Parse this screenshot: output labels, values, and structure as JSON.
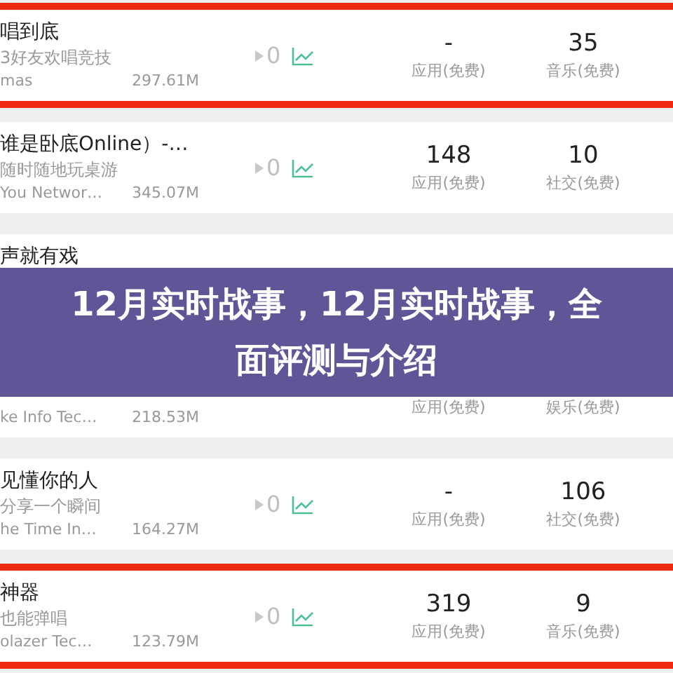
{
  "rows": [
    {
      "name": "唱到底",
      "description": "3好友欢唱竞技",
      "developer": "mas",
      "size": "297.61M",
      "change": "0",
      "highlighted": true,
      "rank_1": {
        "value": "-",
        "category": "应用(免费)"
      },
      "rank_2": {
        "value": "35",
        "category": "音乐(免费)"
      }
    },
    {
      "name": "谁是卧底Online）-…",
      "description": "随时随地玩桌游",
      "developer": "You Networ…",
      "size": "345.07M",
      "change": "0",
      "highlighted": false,
      "rank_1": {
        "value": "148",
        "category": "应用(免费)"
      },
      "rank_2": {
        "value": "10",
        "category": "社交(免费)"
      }
    },
    {
      "name": "声就有戏",
      "highlighted": false
    },
    {
      "developer": "ke Info Tec…",
      "size": "218.53M",
      "highlighted": false,
      "rank_1": {
        "category": "应用(免费)"
      },
      "rank_2": {
        "category": "娱乐(免费)"
      }
    },
    {
      "name": "见懂你的人",
      "description": "分享一个瞬间",
      "developer": "he Time In…",
      "size": "164.27M",
      "change": "0",
      "highlighted": false,
      "rank_1": {
        "value": "-",
        "category": "应用(免费)"
      },
      "rank_2": {
        "value": "106",
        "category": "社交(免费)"
      }
    },
    {
      "name": "神器",
      "description": "也能弹唱",
      "developer": "olazer Tec…",
      "size": "123.79M",
      "change": "0",
      "highlighted": true,
      "rank_1": {
        "value": "319",
        "category": "应用(免费)"
      },
      "rank_2": {
        "value": "9",
        "category": "音乐(免费)"
      }
    }
  ],
  "banner": {
    "title": "12月实时战事，12月实时战事，全面评测与介绍"
  }
}
